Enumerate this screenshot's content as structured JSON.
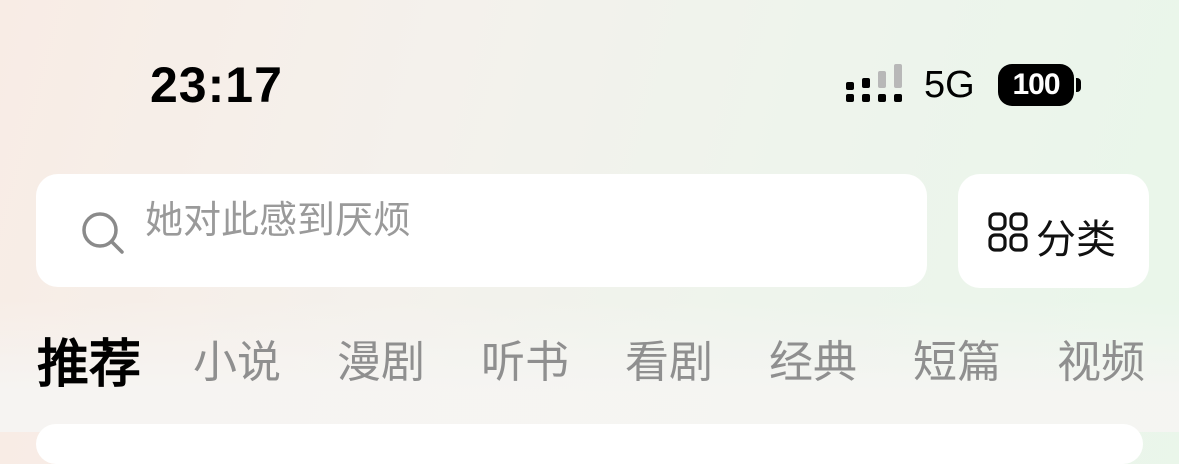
{
  "status_bar": {
    "time": "23:17",
    "network": "5G",
    "battery": "100",
    "signal_icon": "cellular-signal-icon",
    "battery_icon": "battery-icon"
  },
  "search": {
    "placeholder": "她对此感到厌烦",
    "icon": "search-icon"
  },
  "category_button": {
    "label": "分类",
    "icon": "grid-icon"
  },
  "tabs": [
    {
      "label": "推荐",
      "active": true
    },
    {
      "label": "小说",
      "active": false
    },
    {
      "label": "漫剧",
      "active": false
    },
    {
      "label": "听书",
      "active": false
    },
    {
      "label": "看剧",
      "active": false
    },
    {
      "label": "经典",
      "active": false
    },
    {
      "label": "短篇",
      "active": false
    },
    {
      "label": "视频",
      "active": false
    }
  ],
  "colors": {
    "active_tab": "#000000",
    "inactive_tab": "#8f8f8f",
    "placeholder": "#9a9a9a",
    "card_background": "#ffffff"
  }
}
